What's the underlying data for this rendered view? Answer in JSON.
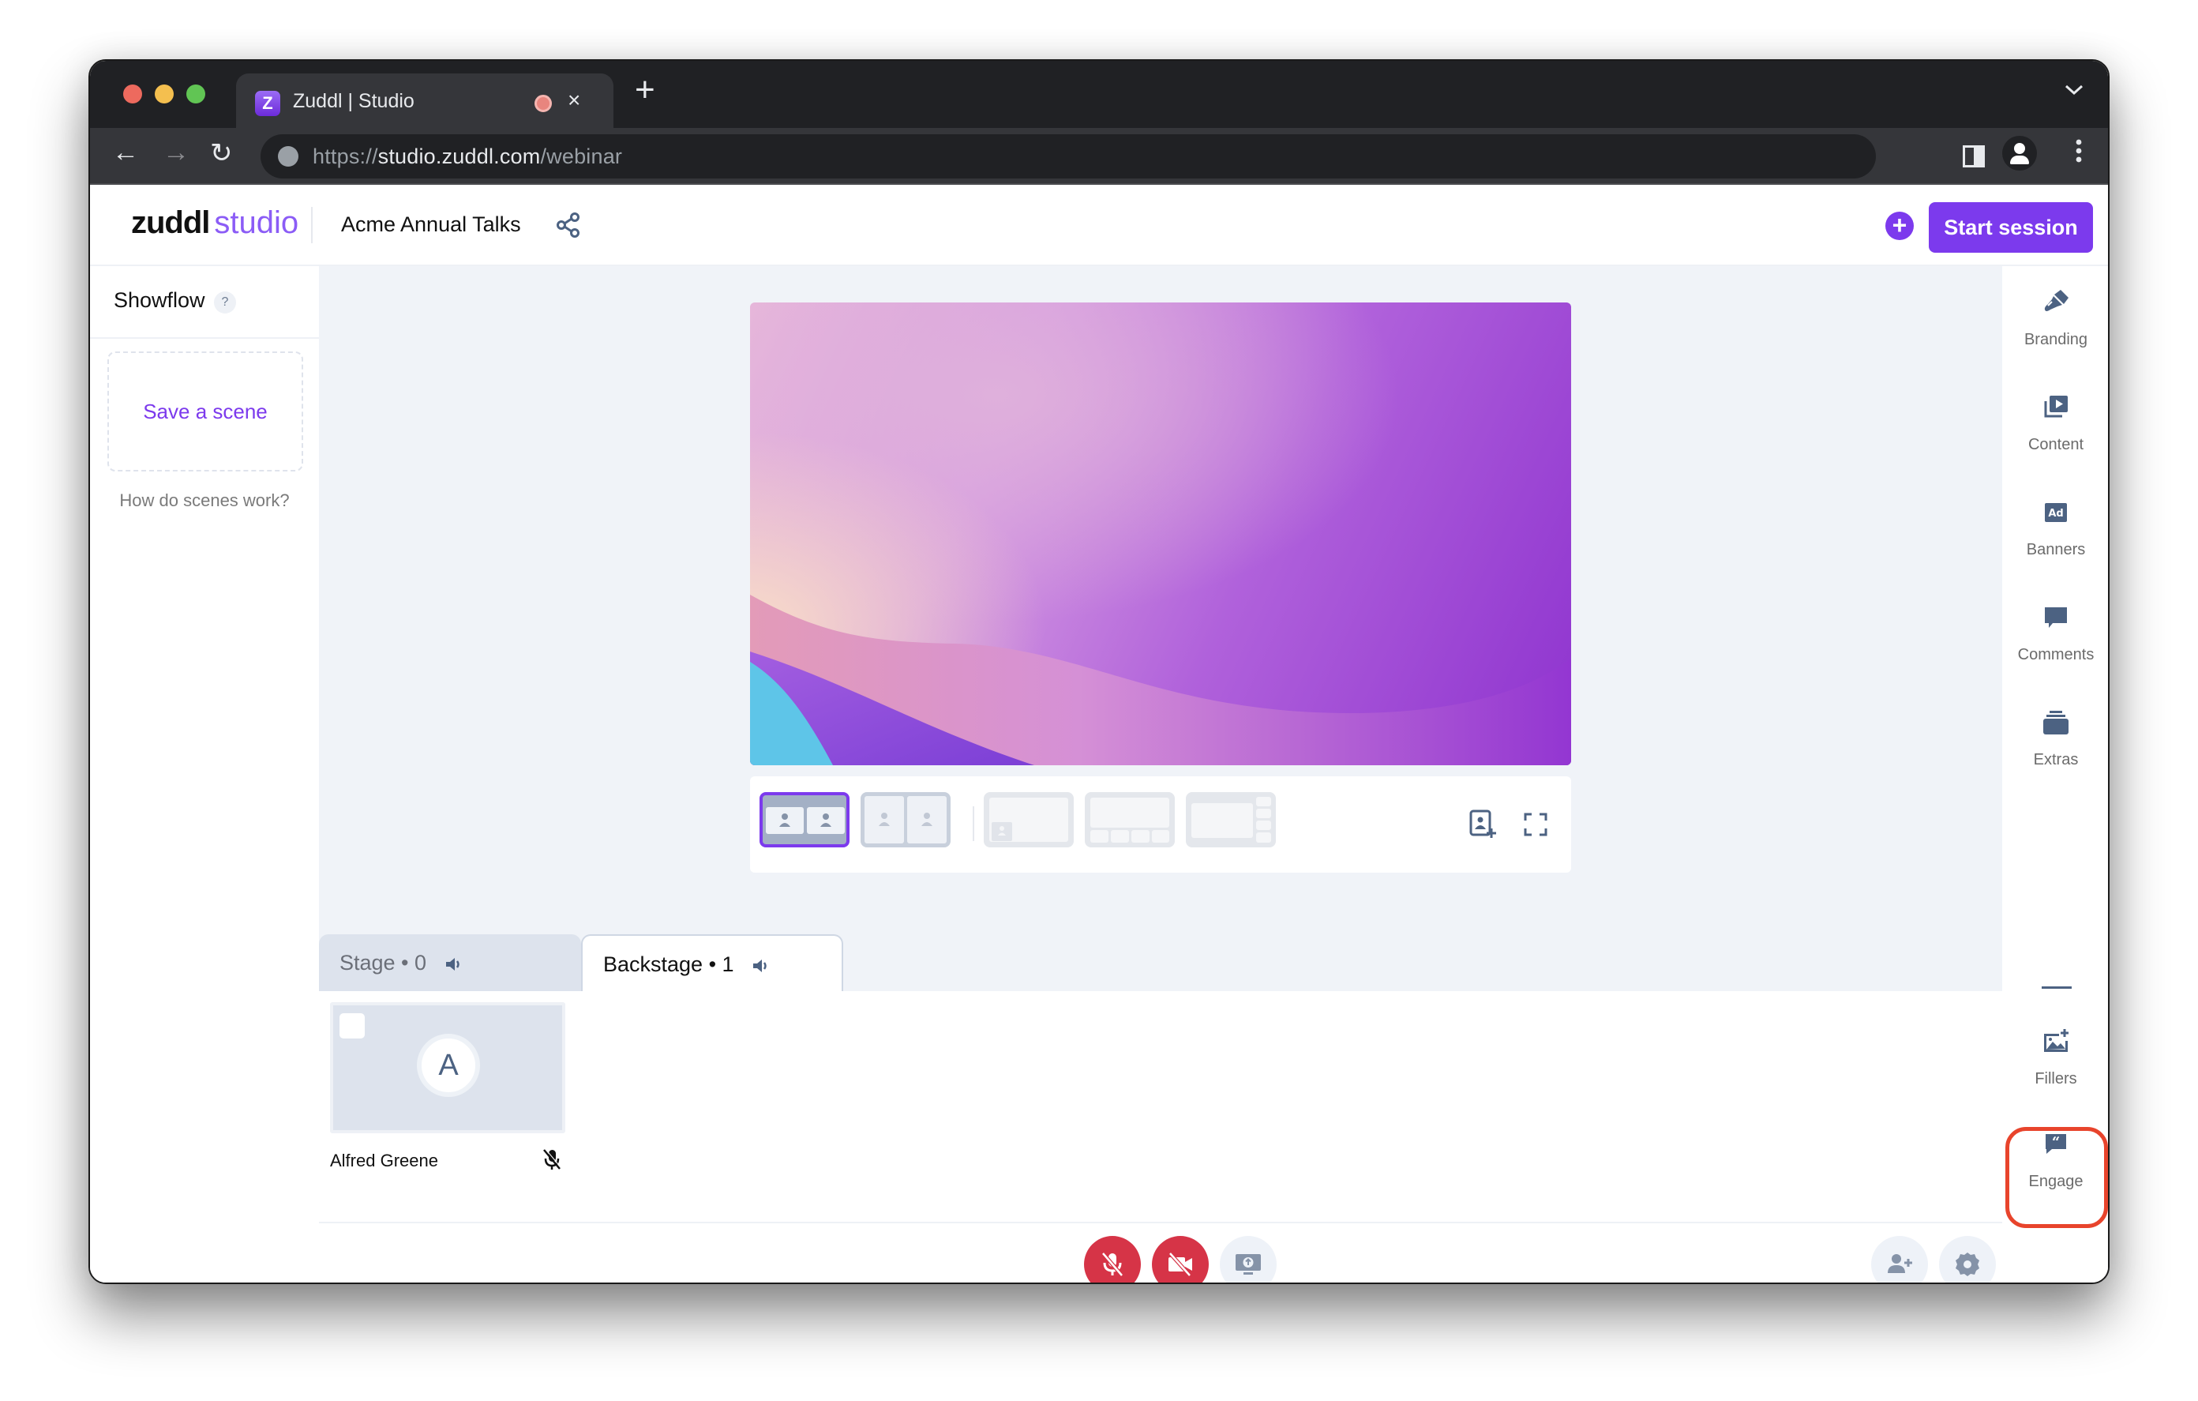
{
  "browser": {
    "tab_title": "Zuddl | Studio",
    "tab_favicon_letter": "Z",
    "url_scheme": "https://",
    "url_host": "studio.zuddl.com",
    "url_path": "/webinar",
    "new_tab_label": "+",
    "close_tab_label": "×",
    "dropdown_label": "⌄",
    "back_label": "←",
    "forward_label": "→",
    "reload_label": "↻",
    "menu_label": "⋮"
  },
  "header": {
    "logo_word": "zuddl",
    "logo_product": "studio",
    "event_name": "Acme Annual Talks",
    "add_label": "+",
    "start_session_label": "Start session"
  },
  "showflow": {
    "title": "Showflow",
    "help_label": "?",
    "save_scene_label": "Save a scene",
    "help_link": "How do scenes work?"
  },
  "right_sidebar": {
    "items": [
      {
        "label": "Branding",
        "icon": "paintbrush-icon"
      },
      {
        "label": "Content",
        "icon": "video-library-icon"
      },
      {
        "label": "Banners",
        "icon": "ad-banner-icon"
      },
      {
        "label": "Comments",
        "icon": "comment-icon"
      },
      {
        "label": "Extras",
        "icon": "layers-icon"
      },
      {
        "label": "Fillers",
        "icon": "add-image-icon"
      },
      {
        "label": "Engage",
        "icon": "quote-bubble-icon",
        "highlighted": true
      }
    ],
    "ad_icon_text": "Ad",
    "quote_icon_text": "“"
  },
  "layouts": {
    "options": [
      {
        "name": "two-up-grid",
        "selected": true
      },
      {
        "name": "two-up-split",
        "selected": false
      },
      {
        "name": "picture-in-picture",
        "selected": false
      },
      {
        "name": "main-with-bottom-strip",
        "selected": false
      },
      {
        "name": "main-with-side-strip",
        "selected": false
      }
    ]
  },
  "stage_tabs": [
    {
      "label": "Stage • 0",
      "active": false
    },
    {
      "label": "Backstage • 1",
      "active": true
    }
  ],
  "backstage": {
    "participants": [
      {
        "name": "Alfred Greene",
        "initial": "A",
        "muted": true
      }
    ]
  },
  "colors": {
    "brand": "#7c3aed",
    "danger": "#d63447",
    "icon": "#4c6282",
    "highlight": "#e8442c"
  }
}
